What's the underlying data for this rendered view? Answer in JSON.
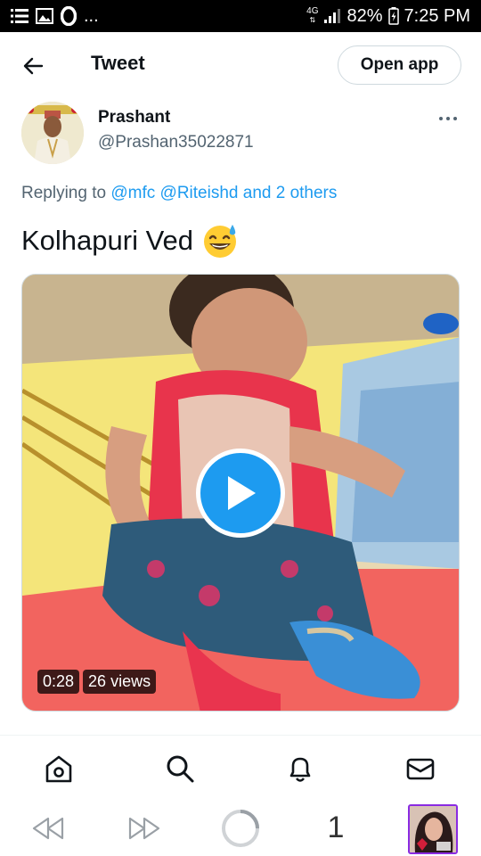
{
  "status_bar": {
    "left_icons": [
      "menu-lines-icon",
      "image-icon",
      "opera-icon"
    ],
    "overflow": "...",
    "network": "4G",
    "battery": "82%",
    "time": "7:25 PM"
  },
  "header": {
    "title": "Tweet",
    "open_app_label": "Open app"
  },
  "tweet": {
    "author": {
      "name": "Prashant",
      "handle": "@Prashan35022871"
    },
    "replying_prefix": "Replying to ",
    "replying_mention_1": "@mfc",
    "replying_mention_2": "@Riteishd",
    "replying_others": "and 2 others",
    "text": "Kolhapuri Ved",
    "emoji": "😅",
    "video": {
      "duration": "0:28",
      "views": "26 views"
    }
  },
  "bottom_nav": [
    "home-icon",
    "search-icon",
    "notifications-icon",
    "messages-icon"
  ],
  "browser_bar": {
    "tab_count": "1"
  },
  "colors": {
    "accent": "#1d9bf0",
    "text": "#0f1419",
    "secondary": "#536471"
  }
}
